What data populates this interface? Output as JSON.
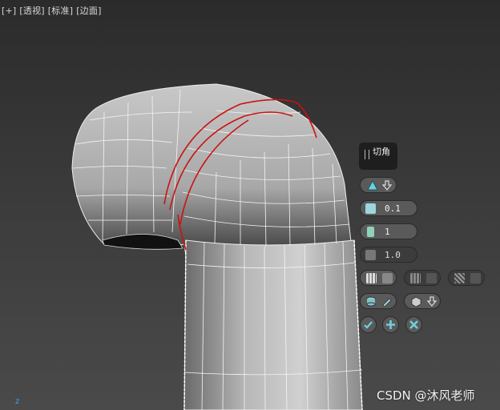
{
  "viewport": {
    "labels": [
      "[+]",
      "[透视]",
      "[标准]",
      "[边面]"
    ]
  },
  "caddy": {
    "title": "切角",
    "chamfer_type_icon": "triangle-icon",
    "amount_value": "0.1",
    "segments_value": "1",
    "tension_value": "1.0",
    "apply_icon": "check-icon",
    "apply_continue_icon": "plus-icon",
    "cancel_icon": "x-icon"
  },
  "axis": {
    "z_label": "z"
  },
  "watermark": "CSDN @沐风老师",
  "colors": {
    "accent": "#6fd0da",
    "selection_edge": "#cc1111",
    "panel_bg": "#1e1e1e"
  }
}
